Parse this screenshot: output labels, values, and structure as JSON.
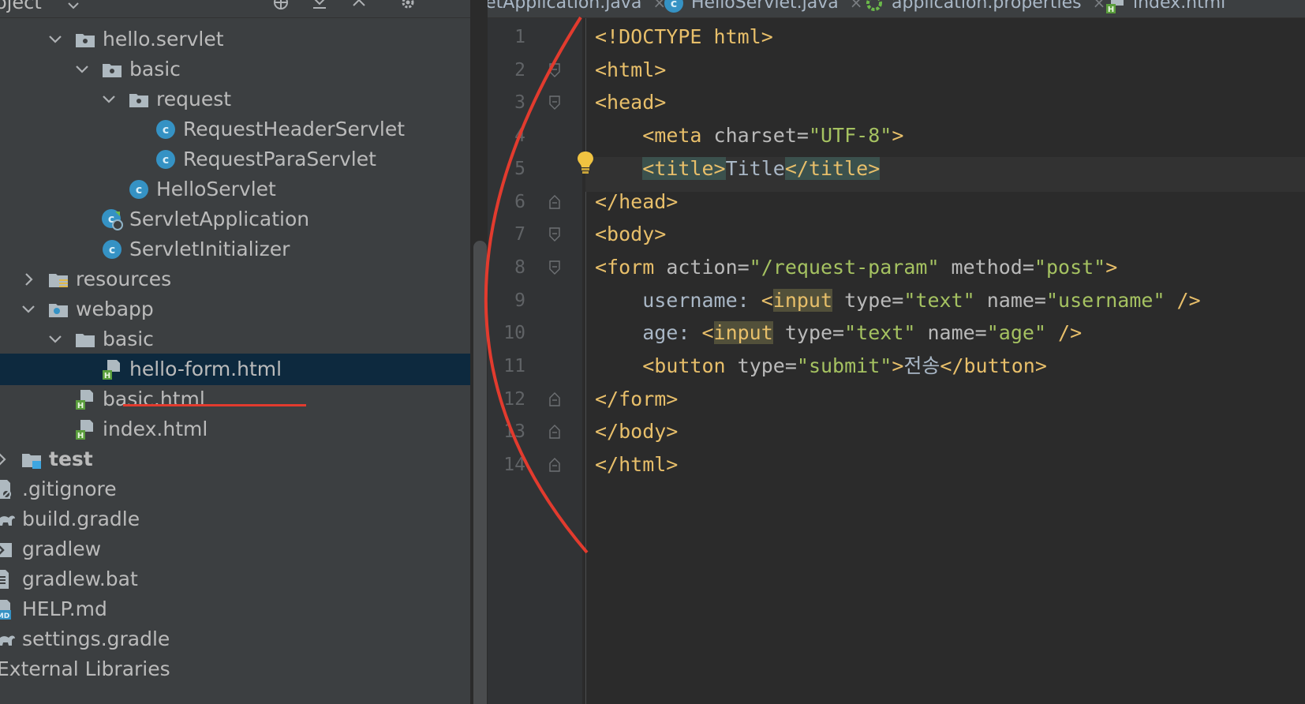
{
  "sidebar": {
    "header_label": "oject",
    "tree": [
      {
        "label": "hello.servlet",
        "icon": "package-folder-icon",
        "expanded": true
      },
      {
        "label": "basic",
        "icon": "package-folder-icon",
        "expanded": true
      },
      {
        "label": "request",
        "icon": "package-folder-icon",
        "expanded": true
      },
      {
        "label": "RequestHeaderServlet",
        "icon": "java-class-icon"
      },
      {
        "label": "RequestParaServlet",
        "icon": "java-class-icon"
      },
      {
        "label": "HelloServlet",
        "icon": "java-class-icon"
      },
      {
        "label": "ServletApplication",
        "icon": "spring-boot-class-icon"
      },
      {
        "label": "ServletInitializer",
        "icon": "java-class-icon"
      },
      {
        "label": "resources",
        "icon": "resources-folder-icon",
        "expanded": false
      },
      {
        "label": "webapp",
        "icon": "web-folder-icon",
        "expanded": true
      },
      {
        "label": "basic",
        "icon": "folder-icon",
        "expanded": true
      },
      {
        "label": "hello-form.html",
        "icon": "html-file-icon",
        "selected": true
      },
      {
        "label": "basic.html",
        "icon": "html-file-icon"
      },
      {
        "label": "index.html",
        "icon": "html-file-icon"
      },
      {
        "label": "test",
        "icon": "test-folder-icon",
        "expanded": false
      },
      {
        "label": ".gitignore",
        "icon": "gitignore-file-icon"
      },
      {
        "label": "build.gradle",
        "icon": "gradle-file-icon"
      },
      {
        "label": "gradlew",
        "icon": "shell-file-icon"
      },
      {
        "label": "gradlew.bat",
        "icon": "text-file-icon"
      },
      {
        "label": "HELP.md",
        "icon": "markdown-file-icon"
      },
      {
        "label": "settings.gradle",
        "icon": "gradle-file-icon"
      },
      {
        "label": "External Libraries",
        "icon": "libraries-icon"
      }
    ]
  },
  "tabs": [
    {
      "label": "vletApplication.java",
      "icon": "java-class-icon"
    },
    {
      "label": "HelloServlet.java",
      "icon": "java-class-icon"
    },
    {
      "label": "application.properties",
      "icon": "properties-file-icon"
    },
    {
      "label": "index.html",
      "icon": "html-file-icon"
    }
  ],
  "editor": {
    "line_numbers": [
      "1",
      "2",
      "3",
      "4",
      "5",
      "6",
      "7",
      "8",
      "9",
      "10",
      "11",
      "12",
      "13",
      "14"
    ],
    "lines": [
      [
        {
          "t": "tag",
          "v": "<!DOCTYPE html>"
        }
      ],
      [
        {
          "t": "tag",
          "v": "<html>"
        }
      ],
      [
        {
          "t": "tag",
          "v": "<head>"
        }
      ],
      [
        {
          "t": "text",
          "v": "    "
        },
        {
          "t": "tag",
          "v": "<meta "
        },
        {
          "t": "attr",
          "v": "charset="
        },
        {
          "t": "val",
          "v": "\"UTF-8\""
        },
        {
          "t": "tag",
          "v": ">"
        }
      ],
      [
        {
          "t": "text",
          "v": "    "
        },
        {
          "t": "tag",
          "v": "<title>",
          "hl": "tag"
        },
        {
          "t": "text",
          "v": "Title"
        },
        {
          "t": "tag",
          "v": "</title>",
          "hl": "tag"
        }
      ],
      [
        {
          "t": "tag",
          "v": "</head>"
        }
      ],
      [
        {
          "t": "tag",
          "v": "<body>"
        }
      ],
      [
        {
          "t": "tag",
          "v": "<form "
        },
        {
          "t": "attr",
          "v": "action="
        },
        {
          "t": "val",
          "v": "\"/request-param\""
        },
        {
          "t": "attr",
          "v": " method="
        },
        {
          "t": "val",
          "v": "\"post\""
        },
        {
          "t": "tag",
          "v": ">"
        }
      ],
      [
        {
          "t": "text",
          "v": "    username: "
        },
        {
          "t": "tag",
          "v": "<"
        },
        {
          "t": "tag",
          "v": "input",
          "hl": "input"
        },
        {
          "t": "attr",
          "v": " type="
        },
        {
          "t": "val",
          "v": "\"text\""
        },
        {
          "t": "attr",
          "v": " name="
        },
        {
          "t": "val",
          "v": "\"username\""
        },
        {
          "t": "tag",
          "v": " />"
        }
      ],
      [
        {
          "t": "text",
          "v": "    age: "
        },
        {
          "t": "tag",
          "v": "<"
        },
        {
          "t": "tag",
          "v": "input",
          "hl": "input"
        },
        {
          "t": "attr",
          "v": " type="
        },
        {
          "t": "val",
          "v": "\"text\""
        },
        {
          "t": "attr",
          "v": " name="
        },
        {
          "t": "val",
          "v": "\"age\""
        },
        {
          "t": "tag",
          "v": " />"
        }
      ],
      [
        {
          "t": "text",
          "v": "    "
        },
        {
          "t": "tag",
          "v": "<button "
        },
        {
          "t": "attr",
          "v": "type="
        },
        {
          "t": "val",
          "v": "\"submit\""
        },
        {
          "t": "tag",
          "v": ">"
        },
        {
          "t": "text",
          "v": "전송"
        },
        {
          "t": "tag",
          "v": "</button>"
        }
      ],
      [
        {
          "t": "tag",
          "v": "</form>"
        }
      ],
      [
        {
          "t": "tag",
          "v": "</body>"
        }
      ],
      [
        {
          "t": "tag",
          "v": "</html>"
        }
      ]
    ]
  },
  "colors": {
    "tag": "#e8bf6a",
    "attr": "#bababa",
    "value": "#a5c261",
    "text": "#a9b7c6",
    "annotation_red": "#e23b2e",
    "selection": "#0d293e"
  }
}
